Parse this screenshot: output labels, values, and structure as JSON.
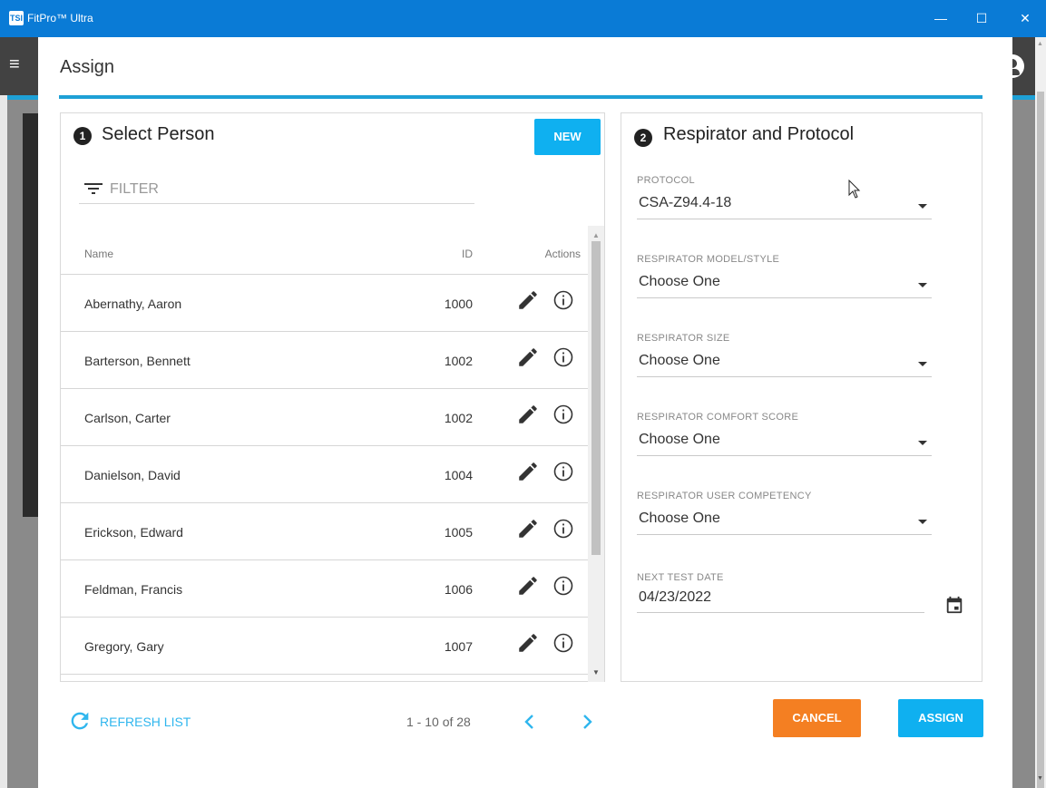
{
  "window": {
    "title": "FitPro™ Ultra",
    "logo_text": "TSI",
    "minimize_glyph": "—",
    "maximize_glyph": "☐",
    "close_glyph": "✕"
  },
  "dialog": {
    "title": "Assign",
    "accent_color": "#1ea0d6"
  },
  "select_person": {
    "step": "1",
    "heading": "Select Person",
    "new_label": "NEW",
    "filter_placeholder": "FILTER",
    "columns": {
      "name": "Name",
      "id": "ID",
      "actions": "Actions"
    },
    "rows": [
      {
        "name": "Abernathy, Aaron",
        "id": "1000"
      },
      {
        "name": "Barterson, Bennett",
        "id": "1002"
      },
      {
        "name": "Carlson, Carter",
        "id": "1002"
      },
      {
        "name": "Danielson, David",
        "id": "1004"
      },
      {
        "name": "Erickson, Edward",
        "id": "1005"
      },
      {
        "name": "Feldman, Francis",
        "id": "1006"
      },
      {
        "name": "Gregory, Gary",
        "id": "1007"
      }
    ],
    "refresh_label": "REFRESH LIST",
    "pagination": "1 - 10 of 28"
  },
  "respirator": {
    "step": "2",
    "heading": "Respirator and Protocol",
    "fields": [
      {
        "label": "PROTOCOL",
        "value": "CSA-Z94.4-18"
      },
      {
        "label": "RESPIRATOR MODEL/STYLE",
        "value": "Choose One"
      },
      {
        "label": "RESPIRATOR SIZE",
        "value": "Choose One"
      },
      {
        "label": "RESPIRATOR COMFORT SCORE",
        "value": "Choose One"
      },
      {
        "label": "RESPIRATOR USER COMPETENCY",
        "value": "Choose One"
      }
    ],
    "next_test_date": {
      "label": "NEXT TEST DATE",
      "value": "04/23/2022"
    }
  },
  "actions": {
    "cancel_label": "CANCEL",
    "assign_label": "ASSIGN",
    "cancel_color": "#f47f22",
    "assign_color": "#0fb0f0"
  }
}
